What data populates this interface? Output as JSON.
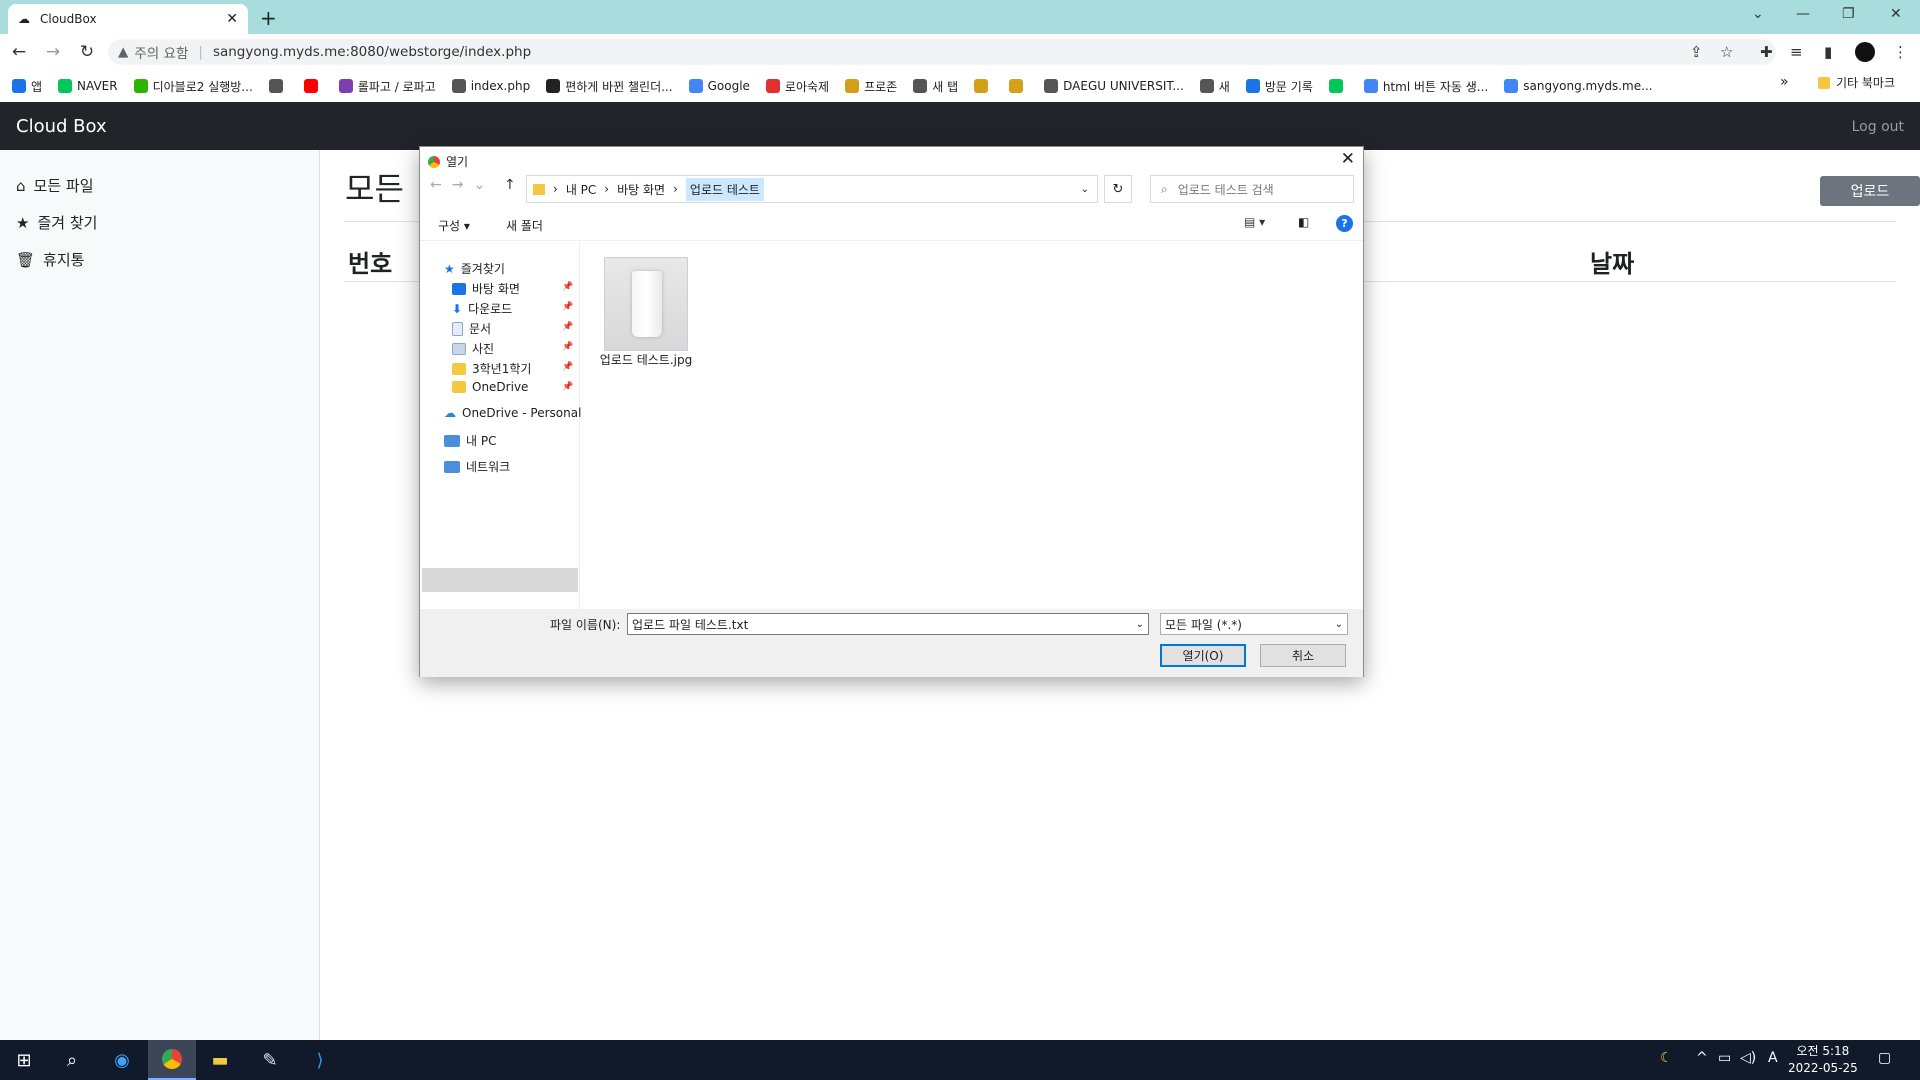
{
  "browser": {
    "tab_title": "CloudBox",
    "url": "sangyong.myds.me:8080/webstorge/index.php",
    "security_label": "주의 요함"
  },
  "bookmarks": {
    "items": [
      {
        "label": "앱",
        "color": "#1a73e8"
      },
      {
        "label": "NAVER",
        "color": "#03c75a"
      },
      {
        "label": "디아블로2 실행방...",
        "color": "#2db400"
      },
      {
        "label": "",
        "color": "#555555"
      },
      {
        "label": "",
        "color": "#ff0000"
      },
      {
        "label": "롤파고 / 로파고",
        "color": "#7b3fb0"
      },
      {
        "label": "index.php",
        "color": "#555555"
      },
      {
        "label": "편하게 바뀐 챌린더...",
        "color": "#222222"
      },
      {
        "label": "Google",
        "color": "#4285f4"
      },
      {
        "label": "로아숙제",
        "color": "#e03030"
      },
      {
        "label": "프로존",
        "color": "#d4a017"
      },
      {
        "label": "새 탭",
        "color": "#555555"
      },
      {
        "label": "",
        "color": "#d4a017"
      },
      {
        "label": "",
        "color": "#d4a017"
      },
      {
        "label": "DAEGU UNIVERSIT...",
        "color": "#555555"
      },
      {
        "label": "새",
        "color": "#555555"
      },
      {
        "label": "방문 기록",
        "color": "#1a73e8"
      },
      {
        "label": "",
        "color": "#03c75a"
      },
      {
        "label": "html 버튼 자동 생...",
        "color": "#4285f4"
      },
      {
        "label": "sangyong.myds.me...",
        "color": "#4285f4"
      }
    ],
    "more": "»",
    "other": "기타 북마크"
  },
  "app": {
    "brand": "Cloud Box",
    "logout": "Log out",
    "sidebar": [
      {
        "icon": "⌂",
        "label": "모든 파일"
      },
      {
        "icon": "★",
        "label": "즐겨 찾기"
      },
      {
        "icon": "🗑",
        "label": "휴지통"
      }
    ],
    "title": "모든",
    "upload_button": "업로드",
    "col_number": "번호",
    "col_date": "날짜"
  },
  "dialog": {
    "title": "열기",
    "path": [
      "내 PC",
      "바탕 화면",
      "업로드 테스트"
    ],
    "search_placeholder": "업로드 테스트 검색",
    "organize": "구성",
    "new_folder": "새 폴더",
    "nav": [
      {
        "label": "즐겨찾기",
        "color": "#1a73e8",
        "pinned": false
      },
      {
        "label": "바탕 화면",
        "color": "#1a73e8",
        "pinned": true
      },
      {
        "label": "다운로드",
        "color": "#1a73e8",
        "pinned": true
      },
      {
        "label": "문서",
        "color": "#8fa8c8",
        "pinned": true
      },
      {
        "label": "사진",
        "color": "#8fa8c8",
        "pinned": true
      },
      {
        "label": "3학년1학기",
        "color": "#f5c842",
        "pinned": true
      },
      {
        "label": "OneDrive",
        "color": "#f5c842",
        "pinned": true
      },
      {
        "label": "OneDrive - Personal",
        "color": "#1e88e5",
        "pinned": false
      },
      {
        "label": "내 PC",
        "color": "#4a90d9",
        "pinned": false
      },
      {
        "label": "네트워크",
        "color": "#4a90d9",
        "pinned": false
      }
    ],
    "file_name": "업로드 테스트.jpg",
    "filename_label": "파일 이름(N):",
    "filename_value": "업로드 파일 테스트.txt",
    "filetype": "모든 파일 (*.*)",
    "open_button": "열기(O)",
    "cancel_button": "취소"
  },
  "taskbar": {
    "time": "오전 5:18",
    "date": "2022-05-25",
    "ime": "A"
  }
}
